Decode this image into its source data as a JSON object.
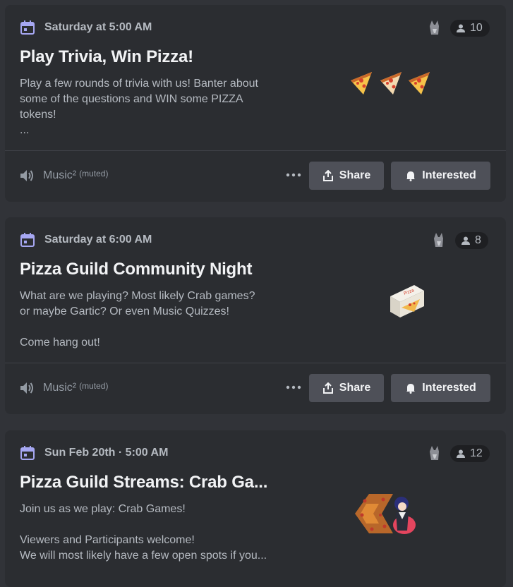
{
  "events": [
    {
      "date": "Saturday at 5:00 AM",
      "title": "Play Trivia, Win Pizza!",
      "description": "Play a few rounds of trivia with us! Banter about\nsome of the questions and WIN some PIZZA\ntokens!\n...",
      "attendee_count": "10",
      "channel": "Music²",
      "channel_status": "(muted)",
      "share_label": "Share",
      "interested_label": "Interested"
    },
    {
      "date": "Saturday at 6:00 AM",
      "title": "Pizza Guild Community Night",
      "description": "What are we playing? Most likely Crab games?\nor maybe Gartic? Or even Music Quizzes!\n\nCome hang out!",
      "attendee_count": "8",
      "channel": "Music²",
      "channel_status": "(muted)",
      "share_label": "Share",
      "interested_label": "Interested"
    },
    {
      "date": "Sun Feb 20th · 5:00 AM",
      "title": "Pizza Guild Streams: Crab Ga...",
      "description": "Join us as we play: Crab Games!\n\nViewers and Participants welcome!\nWe will most likely have a few open spots if you...",
      "attendee_count": "12"
    }
  ],
  "colors": {
    "background": "#313338",
    "card": "#2b2d31",
    "accent_calendar": "#a6a7f2",
    "button": "#4e5058"
  }
}
